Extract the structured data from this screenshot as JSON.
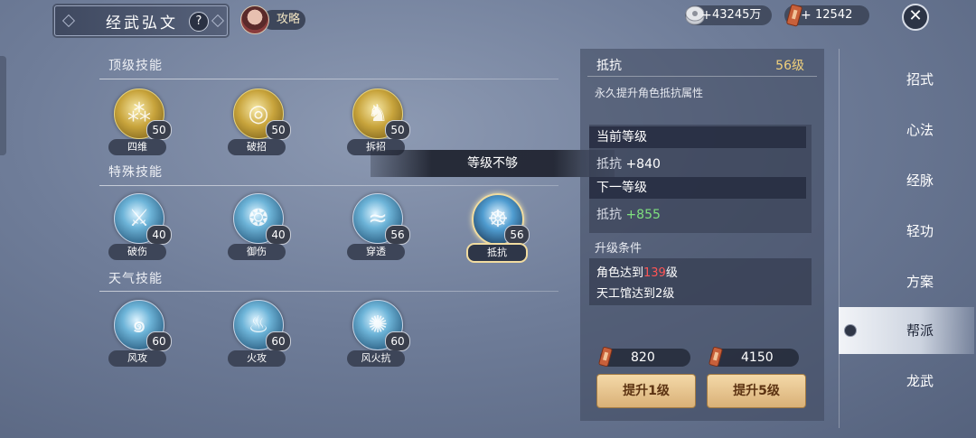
{
  "header": {
    "title": "经武弘文",
    "help_label": "?",
    "guide_label": "攻略",
    "currencies": [
      {
        "icon": "silver-coin-icon",
        "value": "43245万"
      },
      {
        "icon": "token-icon",
        "value": "12542"
      }
    ],
    "close_icon": "close-icon"
  },
  "sections": [
    {
      "title": "顶级技能",
      "skills": [
        {
          "name": "四维",
          "level": "50",
          "icon": "scroll-icon"
        },
        {
          "name": "破招",
          "level": "50",
          "icon": "swirl-icon"
        },
        {
          "name": "拆招",
          "level": "50",
          "icon": "fighter-icon"
        }
      ]
    },
    {
      "title": "特殊技能",
      "skills": [
        {
          "name": "破伤",
          "level": "40",
          "icon": "blade-icon"
        },
        {
          "name": "御伤",
          "level": "40",
          "icon": "shield-icon"
        },
        {
          "name": "穿透",
          "level": "56",
          "icon": "wave-icon"
        },
        {
          "name": "抵抗",
          "level": "56",
          "icon": "meditate-icon",
          "selected": true
        }
      ]
    },
    {
      "title": "天气技能",
      "skills": [
        {
          "name": "风攻",
          "level": "60",
          "icon": "wind-icon"
        },
        {
          "name": "火攻",
          "level": "60",
          "icon": "flame-icon"
        },
        {
          "name": "风火抗",
          "level": "60",
          "icon": "vortex-icon"
        }
      ]
    }
  ],
  "toast": "等级不够",
  "detail": {
    "name": "抵抗",
    "level": "56级",
    "description": "永久提升角色抵抗属性",
    "current_header": "当前等级",
    "current_stat_label": "抵抗",
    "current_stat_value": "+840",
    "next_header": "下一等级",
    "next_stat_label": "抵抗",
    "next_stat_value": "+855",
    "conditions_title": "升级条件",
    "cond1_prefix": "角色达到",
    "cond1_value": "139",
    "cond1_suffix": "级",
    "cond2": "天工馆达到2级",
    "cost1": "820",
    "cost2": "4150",
    "btn1": "提升1级",
    "btn2": "提升5级"
  },
  "nav": [
    "招式",
    "心法",
    "经脉",
    "轻功",
    "方案",
    "帮派",
    "龙武"
  ],
  "nav_active_index": 5,
  "colors": {
    "gold_text": "#f0d07c",
    "green_text": "#7fe07f",
    "red_text": "#ff5555",
    "button": "#e6c48f"
  }
}
